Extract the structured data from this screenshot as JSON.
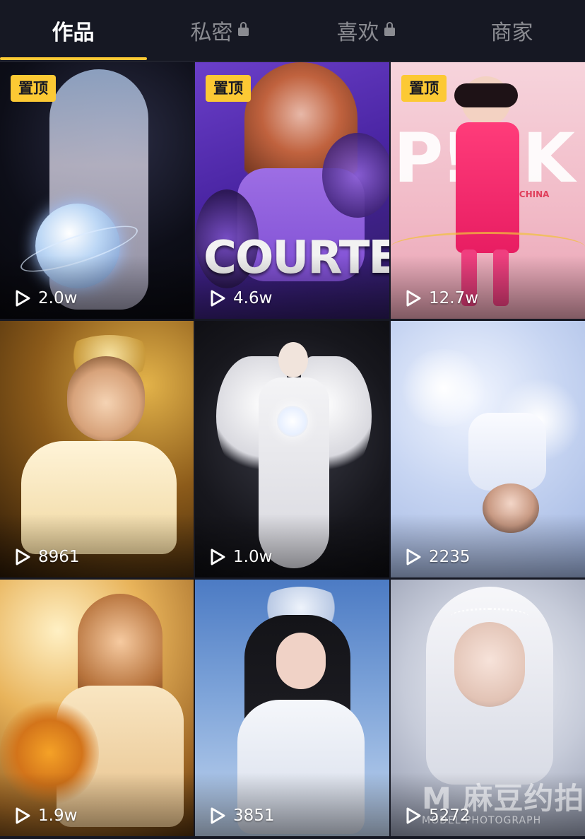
{
  "tabs": [
    {
      "label": "作品",
      "active": true,
      "locked": false
    },
    {
      "label": "私密",
      "active": false,
      "locked": true
    },
    {
      "label": "喜欢",
      "active": false,
      "locked": true
    },
    {
      "label": "商家",
      "active": false,
      "locked": false
    }
  ],
  "accent_color": "#fcc934",
  "pin_label": "置顶",
  "videos": [
    {
      "plays": "2.0w",
      "pinned": true
    },
    {
      "plays": "4.6w",
      "pinned": true,
      "overlay_text": "COURTE"
    },
    {
      "plays": "12.7w",
      "pinned": true,
      "sign_text": "P!NK",
      "sign_sub": "CHIC! CHINA"
    },
    {
      "plays": "8961",
      "pinned": false
    },
    {
      "plays": "1.0w",
      "pinned": false
    },
    {
      "plays": "2235",
      "pinned": false
    },
    {
      "plays": "1.9w",
      "pinned": false
    },
    {
      "plays": "3851",
      "pinned": false
    },
    {
      "plays": "5272",
      "pinned": false
    }
  ],
  "watermark": {
    "main": "M 麻豆约拍",
    "sub": "MODEL PHOTOGRAPH"
  },
  "icons": {
    "play": "play-outline-icon",
    "lock": "lock-icon"
  }
}
